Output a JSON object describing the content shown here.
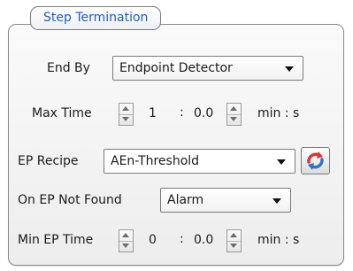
{
  "panel": {
    "title": "Step Termination"
  },
  "end_by": {
    "label": "End By",
    "value": "Endpoint Detector"
  },
  "max_time": {
    "label": "Max Time",
    "minutes": "1",
    "separator": ":",
    "seconds": "0.0",
    "unit": "min : s"
  },
  "ep_recipe": {
    "label": "EP Recipe",
    "value": "AEn-Threshold",
    "refresh_icon": "refresh-icon"
  },
  "on_ep_not_found": {
    "label": "On EP Not Found",
    "value": "Alarm"
  },
  "min_ep_time": {
    "label": "Min EP Time",
    "minutes": "0",
    "separator": ":",
    "seconds": "0.0",
    "unit": "min : s"
  },
  "colors": {
    "title_blue": "#1b5fbf",
    "refresh_red": "#d23b3b",
    "refresh_blue": "#2f73c9"
  }
}
